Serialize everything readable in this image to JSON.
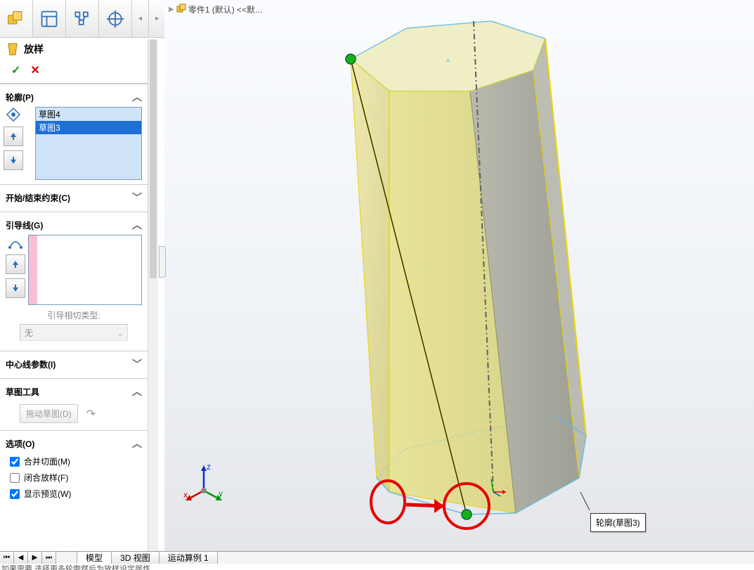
{
  "breadcrumb": {
    "part_label": "零件1 (默认) <<默..."
  },
  "feature": {
    "title": "放样",
    "ok_glyph": "✓",
    "cancel_glyph": "✕"
  },
  "sections": {
    "profiles": {
      "header": "轮廓(P)",
      "items": [
        "草图4",
        "草图3"
      ],
      "selected_index": 1
    },
    "start_end": {
      "header": "开始/结束约束(C)"
    },
    "guides": {
      "header": "引导线(G)",
      "tangent_label": "引导相切类型:",
      "tangent_value": "无"
    },
    "centerline": {
      "header": "中心线参数(I)"
    },
    "sketch_tools": {
      "header": "草图工具",
      "drag_button": "拖动草图(D)"
    },
    "options": {
      "header": "选项(O)",
      "merge_faces": {
        "label": "合并切面(M)",
        "checked": true
      },
      "close_loft": {
        "label": "闭合放样(F)",
        "checked": false
      },
      "show_preview": {
        "label": "显示预览(W)",
        "checked": true
      }
    }
  },
  "tooltip": {
    "text": "轮廓(草图3)"
  },
  "bottom_tabs": [
    "模型",
    "3D 视图",
    "运动算例 1"
  ],
  "bottom_active_index": 0,
  "status": "如果需要    选择更多轮廓然后为放样设定属性",
  "triad": {
    "x": "x",
    "y": "y",
    "z": "z"
  }
}
